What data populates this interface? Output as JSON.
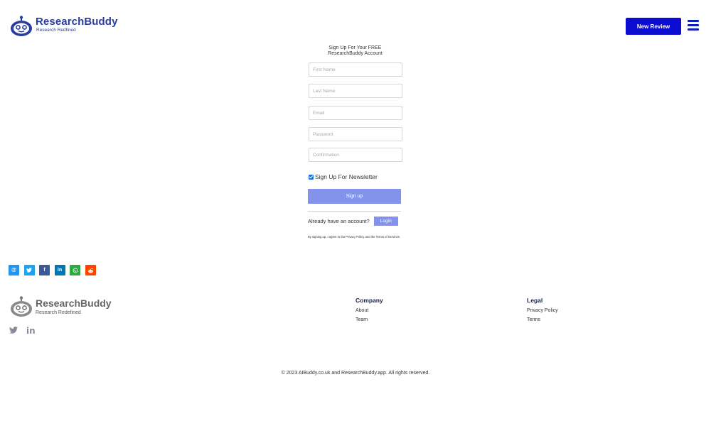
{
  "header": {
    "brand_name": "ResearchBuddy",
    "brand_tagline": "Research Redfined",
    "new_review_label": "New Review",
    "logo_icon": "robot-logo-icon",
    "menu_icon": "hamburger-menu-icon",
    "accent_color": "#0d0dd2"
  },
  "form": {
    "title_line1": "Sign Up For Your FREE",
    "title_line2": "ResearchBuddy Account",
    "first_name_placeholder": "First Name",
    "last_name_placeholder": "Last Name",
    "email_placeholder": "Email",
    "password_placeholder": "Password",
    "confirmation_placeholder": "Confirmation",
    "newsletter_label": "Sign Up For Newsletter",
    "newsletter_checked": true,
    "signup_label": "Sign up",
    "already_text": "Already have an account?",
    "login_label": "Login",
    "legal_note": "By signing up, I agree to the Privacy Policy and the Terms of Services.",
    "button_color": "#8393ec"
  },
  "share": [
    {
      "icon": "email-share-icon",
      "glyph": "@",
      "color": "#2196f3"
    },
    {
      "icon": "twitter-share-icon",
      "glyph": "t",
      "color": "#1da1f2"
    },
    {
      "icon": "facebook-share-icon",
      "glyph": "f",
      "color": "#3b5998"
    },
    {
      "icon": "linkedin-share-icon",
      "glyph": "in",
      "color": "#0077b5"
    },
    {
      "icon": "whatsapp-share-icon",
      "glyph": "w",
      "color": "#2eaa44"
    },
    {
      "icon": "reddit-share-icon",
      "glyph": "r",
      "color": "#ff4500"
    }
  ],
  "footer": {
    "brand_name": "ResearchBuddy",
    "brand_tagline": "Research Redefined",
    "social_icons": [
      "twitter-icon",
      "linkedin-icon"
    ],
    "company": {
      "heading": "Company",
      "links": [
        "About",
        "Team"
      ]
    },
    "legal": {
      "heading": "Legal",
      "links": [
        "Privacy Policy",
        "Terms"
      ]
    },
    "copyright": "© 2023 AIBuddy.co.uk and ResearchBuddy.app. All rights reserved."
  }
}
